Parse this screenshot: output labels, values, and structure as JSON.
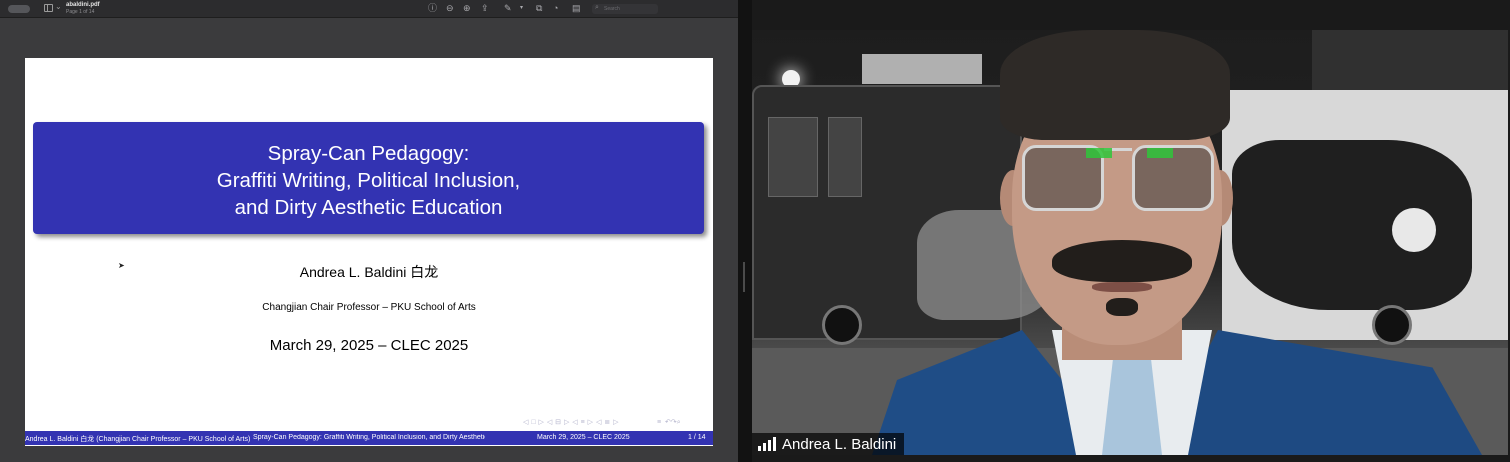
{
  "viewer": {
    "filename": "abaldini.pdf",
    "page_indicator": "Page 1 of 14",
    "search_placeholder": "Search",
    "icons": [
      "sidebar-icon",
      "info-icon",
      "zoom-out-icon",
      "zoom-in-icon",
      "share-icon",
      "markup-pen-icon",
      "rotate-icon",
      "highlight-icon",
      "form-icon",
      "search-icon"
    ]
  },
  "slide": {
    "title_lines": [
      "Spray-Can Pedagogy:",
      "Graffiti Writing, Political Inclusion,",
      "and Dirty Aesthetic Education"
    ],
    "author": "Andrea L. Baldini 白龙",
    "affiliation": "Changjian Chair Professor – PKU School of Arts",
    "date": "March 29, 2025 – CLEC 2025",
    "footer": {
      "author": "Andrea L. Baldini 白龙  (Changjian Chair Professor – PKU School of Arts)",
      "title": "Spray-Can Pedagogy:  Graffiti Writing, Political Inclusion,  and Dirty Aesthetic Education",
      "date": "March 29, 2025 – CLEC 2025",
      "page": "1 / 14"
    },
    "colors": {
      "beamer_blue": "#3333b2",
      "background": "#ffffff"
    }
  },
  "video": {
    "participant_name": "Andrea L. Baldini",
    "signal_icon": "signal-bars-icon"
  }
}
